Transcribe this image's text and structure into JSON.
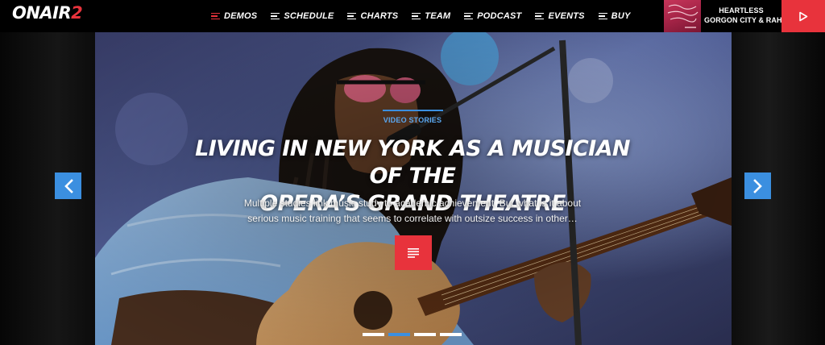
{
  "brand": {
    "logo_text": "ONAIR",
    "logo_num": "2",
    "accent": "#e8333c",
    "highlight": "#3b8fe0"
  },
  "nav": {
    "items": [
      {
        "label": "DEMOS",
        "active": true
      },
      {
        "label": "SCHEDULE"
      },
      {
        "label": "CHARTS"
      },
      {
        "label": "TEAM"
      },
      {
        "label": "PODCAST"
      },
      {
        "label": "EVENTS"
      },
      {
        "label": "BUY"
      }
    ]
  },
  "now_playing": {
    "title": "HEARTLESS",
    "artist": "GORGON CITY & RAHH",
    "play_icon": "play-icon"
  },
  "hero": {
    "category": "VIDEO STORIES",
    "title_line1": "LIVING IN NEW YORK AS A MUSICIAN OF THE",
    "title_line2": "OPERA’S GRAND THEATRE",
    "excerpt_line1": "Multiple studies link music study to academic achievement. But what is it about",
    "excerpt_line2": "serious music training that seems to correlate with outsize success in other…",
    "read_icon": "article-icon",
    "prev_icon": "chevron-left-icon",
    "next_icon": "chevron-right-icon",
    "slides": 4,
    "active_slide": 2
  }
}
